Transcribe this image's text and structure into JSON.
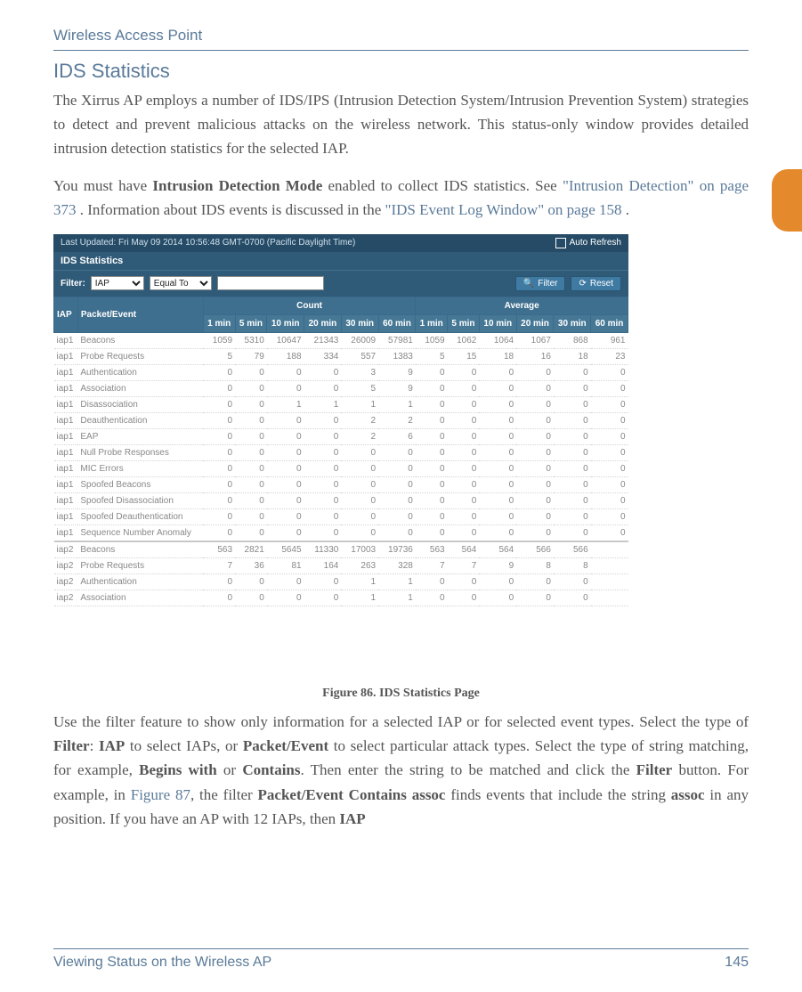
{
  "running_header": "Wireless Access Point",
  "heading": "IDS Statistics",
  "para1": "The Xirrus AP employs a number of IDS/IPS (Intrusion Detection System/Intrusion Prevention System) strategies to detect and prevent malicious attacks on the wireless network. This status-only window provides detailed intrusion detection statistics for the selected IAP.",
  "para2_pre": "You must have ",
  "para2_bold1": "Intrusion Detection Mode",
  "para2_mid1": " enabled to collect IDS statistics. See ",
  "para2_link1": "\"Intrusion Detection\" on page 373",
  "para2_mid2": ". Information about IDS events is discussed in the ",
  "para2_link2": "\"IDS Event Log Window\" on page 158",
  "para2_end": ".",
  "fig": {
    "last_updated": "Last Updated: Fri May 09 2014 10:56:48 GMT-0700 (Pacific Daylight Time)",
    "auto_refresh": "Auto Refresh",
    "section_title": "IDS Statistics",
    "filter_label": "Filter:",
    "filter_type_value": "IAP",
    "filter_match_value": "Equal To",
    "filter_text_value": "",
    "btn_filter": "Filter",
    "btn_reset": "Reset",
    "col_iap": "IAP",
    "col_event": "Packet/Event",
    "group_count": "Count",
    "group_avg": "Average",
    "cols_count": [
      "1 min",
      "5 min",
      "10 min",
      "20 min",
      "30 min",
      "60 min"
    ],
    "cols_avg": [
      "1 min",
      "5 min",
      "10 min",
      "20 min",
      "30 min",
      "60 min"
    ],
    "rows": [
      {
        "iap": "iap1",
        "ev": "Beacons",
        "c": [
          "1059",
          "5310",
          "10647",
          "21343",
          "26009",
          "57981"
        ],
        "a": [
          "1059",
          "1062",
          "1064",
          "1067",
          "868",
          "961"
        ]
      },
      {
        "iap": "iap1",
        "ev": "Probe Requests",
        "c": [
          "5",
          "79",
          "188",
          "334",
          "557",
          "1383"
        ],
        "a": [
          "5",
          "15",
          "18",
          "16",
          "18",
          "23"
        ]
      },
      {
        "iap": "iap1",
        "ev": "Authentication",
        "c": [
          "0",
          "0",
          "0",
          "0",
          "3",
          "9"
        ],
        "a": [
          "0",
          "0",
          "0",
          "0",
          "0",
          "0"
        ]
      },
      {
        "iap": "iap1",
        "ev": "Association",
        "c": [
          "0",
          "0",
          "0",
          "0",
          "5",
          "9"
        ],
        "a": [
          "0",
          "0",
          "0",
          "0",
          "0",
          "0"
        ]
      },
      {
        "iap": "iap1",
        "ev": "Disassociation",
        "c": [
          "0",
          "0",
          "1",
          "1",
          "1",
          "1"
        ],
        "a": [
          "0",
          "0",
          "0",
          "0",
          "0",
          "0"
        ]
      },
      {
        "iap": "iap1",
        "ev": "Deauthentication",
        "c": [
          "0",
          "0",
          "0",
          "0",
          "2",
          "2"
        ],
        "a": [
          "0",
          "0",
          "0",
          "0",
          "0",
          "0"
        ]
      },
      {
        "iap": "iap1",
        "ev": "EAP",
        "c": [
          "0",
          "0",
          "0",
          "0",
          "2",
          "6"
        ],
        "a": [
          "0",
          "0",
          "0",
          "0",
          "0",
          "0"
        ]
      },
      {
        "iap": "iap1",
        "ev": "Null Probe Responses",
        "c": [
          "0",
          "0",
          "0",
          "0",
          "0",
          "0"
        ],
        "a": [
          "0",
          "0",
          "0",
          "0",
          "0",
          "0"
        ]
      },
      {
        "iap": "iap1",
        "ev": "MIC Errors",
        "c": [
          "0",
          "0",
          "0",
          "0",
          "0",
          "0"
        ],
        "a": [
          "0",
          "0",
          "0",
          "0",
          "0",
          "0"
        ]
      },
      {
        "iap": "iap1",
        "ev": "Spoofed Beacons",
        "c": [
          "0",
          "0",
          "0",
          "0",
          "0",
          "0"
        ],
        "a": [
          "0",
          "0",
          "0",
          "0",
          "0",
          "0"
        ]
      },
      {
        "iap": "iap1",
        "ev": "Spoofed Disassociation",
        "c": [
          "0",
          "0",
          "0",
          "0",
          "0",
          "0"
        ],
        "a": [
          "0",
          "0",
          "0",
          "0",
          "0",
          "0"
        ]
      },
      {
        "iap": "iap1",
        "ev": "Spoofed Deauthentication",
        "c": [
          "0",
          "0",
          "0",
          "0",
          "0",
          "0"
        ],
        "a": [
          "0",
          "0",
          "0",
          "0",
          "0",
          "0"
        ]
      },
      {
        "iap": "iap1",
        "ev": "Sequence Number Anomaly",
        "c": [
          "0",
          "0",
          "0",
          "0",
          "0",
          "0"
        ],
        "a": [
          "0",
          "0",
          "0",
          "0",
          "0",
          "0"
        ],
        "sep": true
      },
      {
        "iap": "iap2",
        "ev": "Beacons",
        "c": [
          "563",
          "2821",
          "5645",
          "11330",
          "17003",
          "19736"
        ],
        "a": [
          "563",
          "564",
          "564",
          "566",
          "566",
          ""
        ]
      },
      {
        "iap": "iap2",
        "ev": "Probe Requests",
        "c": [
          "7",
          "36",
          "81",
          "164",
          "263",
          "328"
        ],
        "a": [
          "7",
          "7",
          "9",
          "8",
          "8",
          ""
        ]
      },
      {
        "iap": "iap2",
        "ev": "Authentication",
        "c": [
          "0",
          "0",
          "0",
          "0",
          "1",
          "1"
        ],
        "a": [
          "0",
          "0",
          "0",
          "0",
          "0",
          ""
        ]
      },
      {
        "iap": "iap2",
        "ev": "Association",
        "c": [
          "0",
          "0",
          "0",
          "0",
          "1",
          "1"
        ],
        "a": [
          "0",
          "0",
          "0",
          "0",
          "0",
          ""
        ]
      }
    ]
  },
  "fig_caption": "Figure 86. IDS Statistics Page",
  "para3_parts": {
    "t1": "Use the filter feature to show only information for a selected IAP or for selected event types. Select the type of ",
    "b1": "Filter",
    "t2": ": ",
    "b2": "IAP",
    "t3": " to select IAPs, or ",
    "b3": "Packet/Event",
    "t4": " to select particular attack types. Select the type of string matching, for example, ",
    "b4": "Begins with",
    "t5": " or ",
    "b5": "Contains",
    "t6": ". Then enter the string to be matched and click the ",
    "b6": "Filter",
    "t7": " button. For example, in ",
    "l1": "Figure 87",
    "t8": ", the filter ",
    "b7": "Packet/Event Contains assoc",
    "t9": " finds events that include the string ",
    "b8": "assoc",
    "t10": " in any position. If you have an AP with 12 IAPs, then ",
    "b9": "IAP"
  },
  "footer_left": "Viewing Status on the Wireless AP",
  "footer_right": "145"
}
